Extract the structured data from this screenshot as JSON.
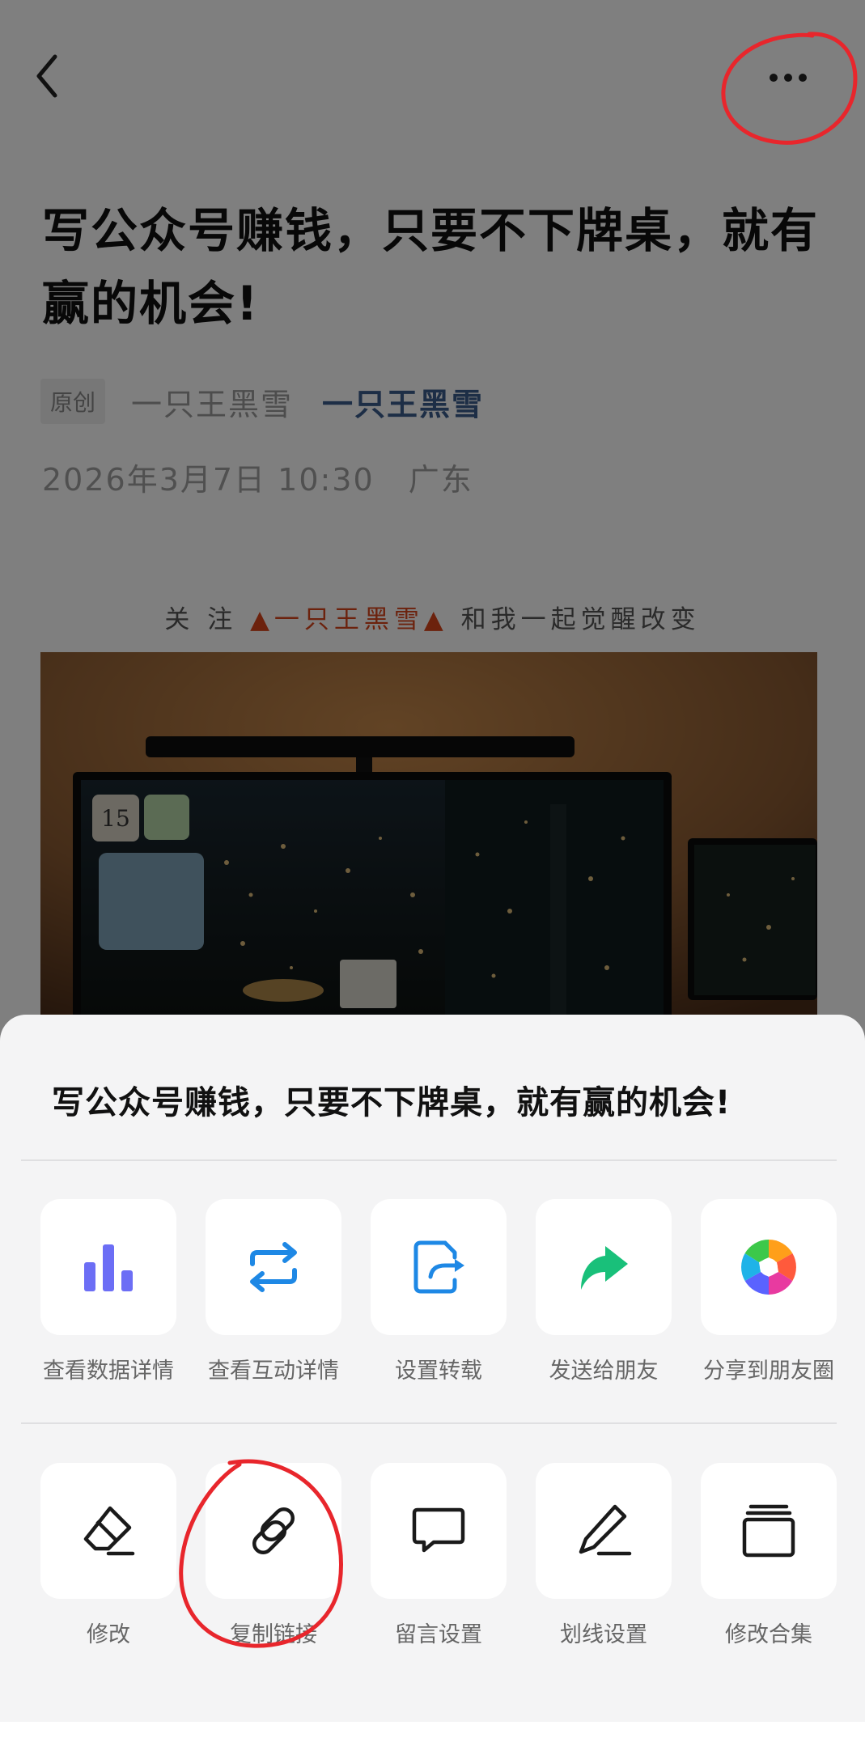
{
  "article": {
    "title": "写公众号赚钱，只要不下牌桌，就有赢的机会!",
    "tag": "原创",
    "author_gray": "一只王黑雪",
    "author_link": "一只王黑雪",
    "date": "2026年3月7日 10:30",
    "location": "广东",
    "follow_prefix": "关 注",
    "follow_account": "▲一只王黑雪▲",
    "follow_suffix": "和我一起觉醒改变",
    "photo_calendar_number": "15"
  },
  "nav": {
    "back_icon": "chevron-left-icon",
    "more_icon": "more-dots-icon"
  },
  "sheet": {
    "title": "写公众号赚钱，只要不下牌桌，就有赢的机会!",
    "row1": [
      {
        "label": "查看数据详情",
        "icon": "bar-chart-icon"
      },
      {
        "label": "查看互动详情",
        "icon": "repeat-icon"
      },
      {
        "label": "设置转载",
        "icon": "repost-icon"
      },
      {
        "label": "发送给朋友",
        "icon": "share-arrow-icon"
      },
      {
        "label": "分享到朋友圈",
        "icon": "moments-icon"
      }
    ],
    "row2": [
      {
        "label": "修改",
        "icon": "eraser-icon"
      },
      {
        "label": "复制链接",
        "icon": "link-icon"
      },
      {
        "label": "留言设置",
        "icon": "comment-icon"
      },
      {
        "label": "划线设置",
        "icon": "pencil-icon"
      },
      {
        "label": "修改合集",
        "icon": "collection-icon"
      }
    ]
  },
  "colors": {
    "accent_blue": "#1e88e5",
    "chart_purple": "#6c6ef5",
    "send_green": "#19c07a",
    "follow_orange": "#d9441a",
    "annotation_red": "#e8262c"
  }
}
